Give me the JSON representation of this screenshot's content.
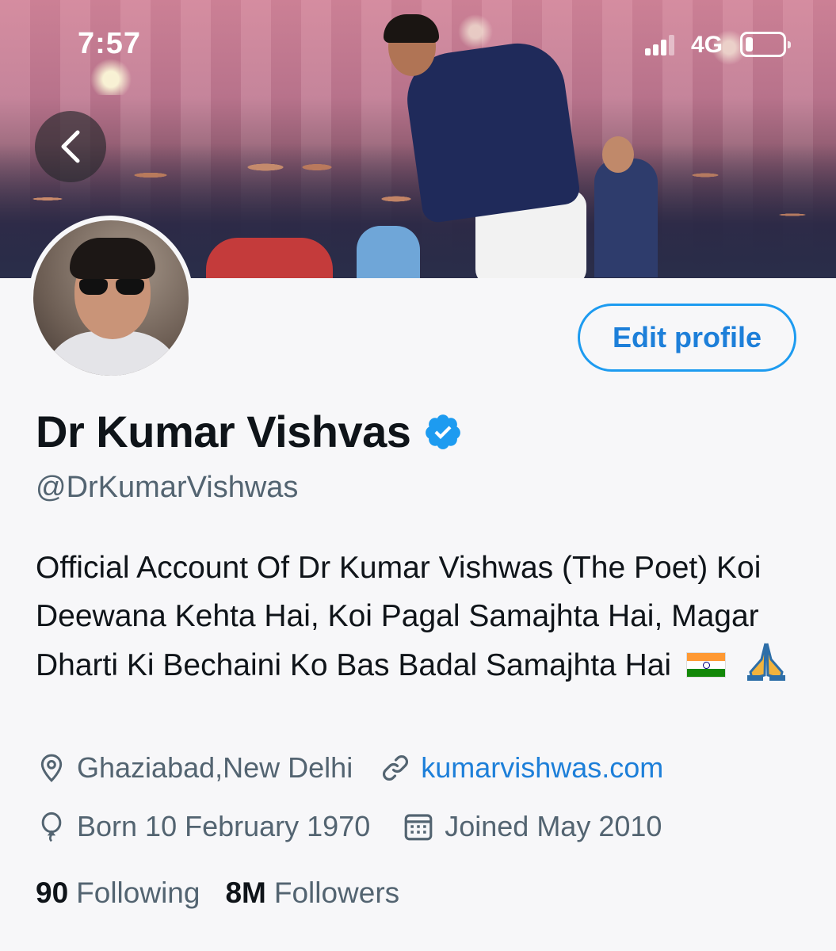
{
  "status_bar": {
    "time": "7:57",
    "network": "4G"
  },
  "profile": {
    "display_name": "Dr Kumar Vishvas",
    "verified": true,
    "handle": "@DrKumarVishwas",
    "edit_button_label": "Edit profile",
    "bio": "Official Account Of Dr Kumar Vishwas (The Poet) Koi Deewana Kehta Hai, Koi Pagal Samajhta Hai, Magar Dharti Ki Bechaini Ko Bas Badal Samajhta Hai",
    "location": "Ghaziabad,New Delhi",
    "website": "kumarvishwas.com",
    "birthday": "Born 10 February 1970",
    "joined": "Joined May 2010",
    "following_count": "90",
    "following_label": "Following",
    "followers_count": "8M",
    "followers_label": "Followers"
  },
  "colors": {
    "accent": "#1d9bf0",
    "link": "#1d7fd9",
    "secondary_text": "#536471",
    "background": "#f7f7f9"
  },
  "icons": [
    "back-icon",
    "verified-badge-icon",
    "location-icon",
    "link-icon",
    "birthday-balloon-icon",
    "calendar-icon",
    "signal-icon",
    "battery-icon"
  ]
}
